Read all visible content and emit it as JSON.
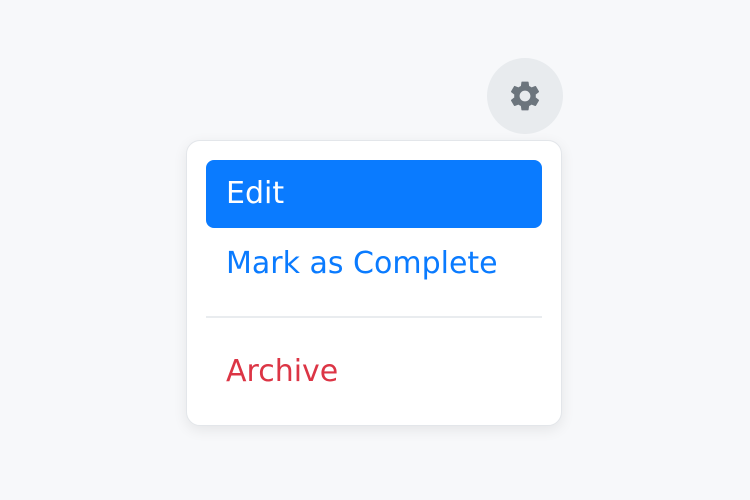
{
  "gear_button": {
    "icon": "gear-icon",
    "color": "#6c757d",
    "background": "#e8ebee"
  },
  "menu": {
    "items": [
      {
        "label": "Edit",
        "state": "highlighted",
        "color": "#0a7bff"
      },
      {
        "label": "Mark as Complete",
        "color": "#0a7bff"
      },
      {
        "label": "Archive",
        "color": "#dc3545"
      }
    ]
  }
}
